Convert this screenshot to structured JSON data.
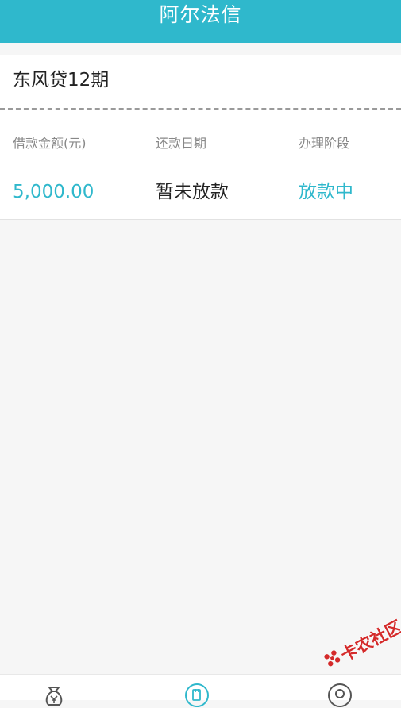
{
  "header": {
    "title": "阿尔法信"
  },
  "loan": {
    "name": "东风贷12期",
    "columns": [
      {
        "label": "借款金额(元)",
        "value": "5,000.00"
      },
      {
        "label": "还款日期",
        "value": "暂未放款"
      },
      {
        "label": "办理阶段",
        "value": "放款中"
      }
    ]
  },
  "watermark": {
    "text": "卡农社区"
  },
  "colors": {
    "accent": "#2fb8cc",
    "watermark": "#d42a2a"
  },
  "tabbar": {
    "icons": [
      "money-bag-icon",
      "record-icon",
      "profile-icon"
    ],
    "active_index": 1
  }
}
